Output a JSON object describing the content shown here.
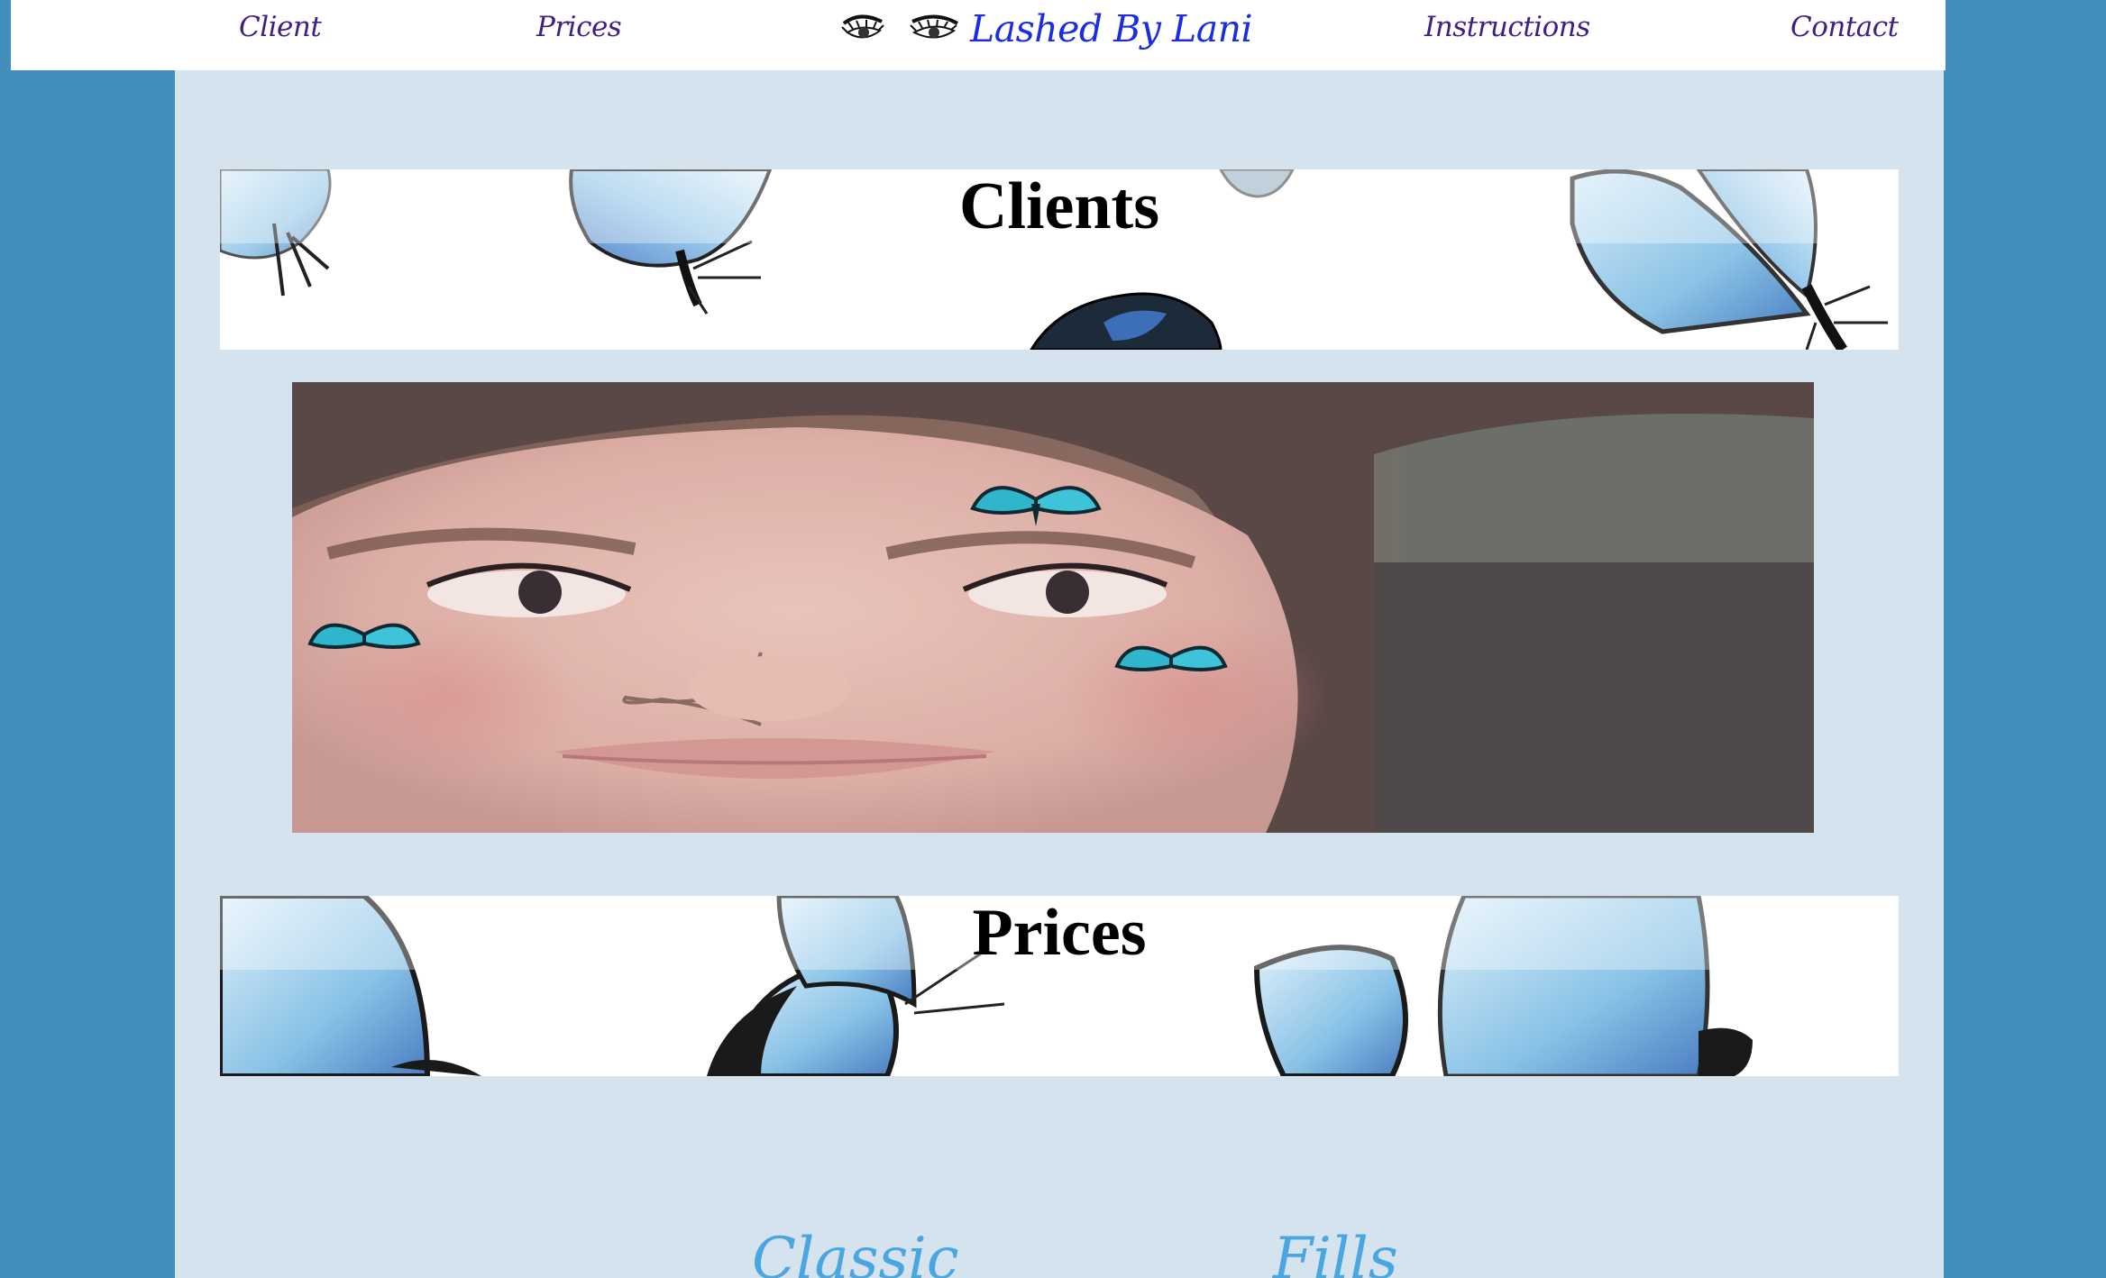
{
  "nav": {
    "links": [
      "Client",
      "Prices",
      "Instructions",
      "Contact"
    ],
    "brand": "Lashed By Lani",
    "logo_icon": "eyelash-logo-icon"
  },
  "sections": {
    "clients_title": "Clients",
    "prices_title": "Prices",
    "price_headings": [
      "Classic",
      "Fills"
    ]
  },
  "photo": {
    "icon": "client-face-with-butterflies-photo"
  },
  "colors": {
    "page_background": "#418ebd",
    "content_background": "#d4e3ee",
    "nav_link": "#3f1f86",
    "brand": "#1a2de0",
    "section_heading": "#4aa6e0",
    "butterfly": "#7fb8e0"
  }
}
